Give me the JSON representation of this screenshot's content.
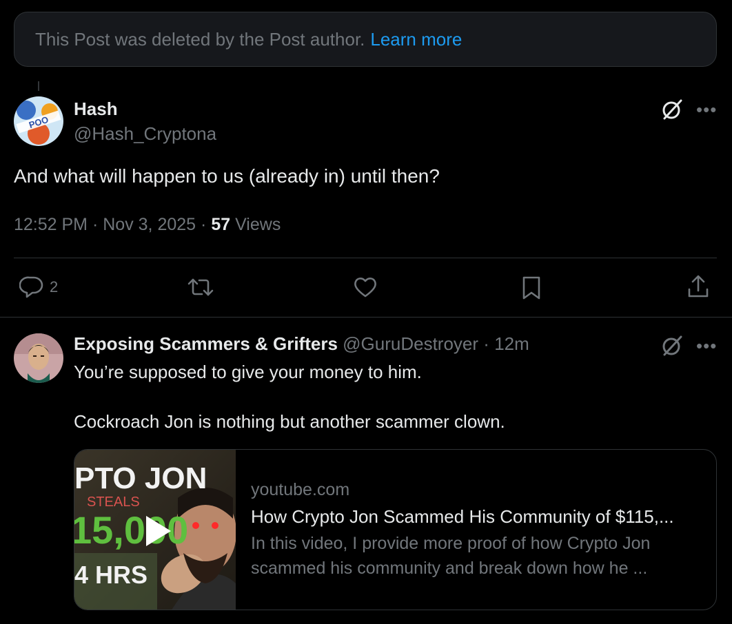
{
  "deleted_notice": {
    "text": "This Post was deleted by the Post author.",
    "link": "Learn more"
  },
  "main_post": {
    "author_name": "Hash",
    "handle": "@Hash_Cryptona",
    "avatar_text": "POO",
    "text": "And what will happen to us (already in) until then?",
    "time": "12:52 PM",
    "date": "Nov 3, 2025",
    "views_count": "57",
    "views_label": "Views",
    "reply_count": "2",
    "more_glyph": "•••"
  },
  "reply": {
    "author_name": "Exposing Scammers & Grifters",
    "handle": "@GuruDestroyer",
    "time": "12m",
    "line1": "You’re supposed to give your money to him.",
    "line2": "Cockroach Jon is nothing but another scammer clown.",
    "more_glyph": "•••",
    "card": {
      "thumb_line1": "PTO JON",
      "thumb_line2": "STEALS",
      "thumb_line3": "15,000",
      "thumb_line4": "4 HRS",
      "domain": "youtube.com",
      "title": "How Crypto Jon Scammed His Community of $115,...",
      "desc1": "In this video, I provide more proof of how Crypto Jon",
      "desc2": "scammed his community and break down how he ..."
    }
  },
  "colors": {
    "background": "#000000",
    "banner_bg": "#16181c",
    "link": "#1d9bf0",
    "muted": "#71767b",
    "text": "#e7e9ea",
    "border": "#2f3336"
  },
  "icons": [
    "grok-icon",
    "more-icon",
    "reply-icon",
    "repost-icon",
    "like-icon",
    "bookmark-icon",
    "share-icon",
    "play-icon"
  ]
}
